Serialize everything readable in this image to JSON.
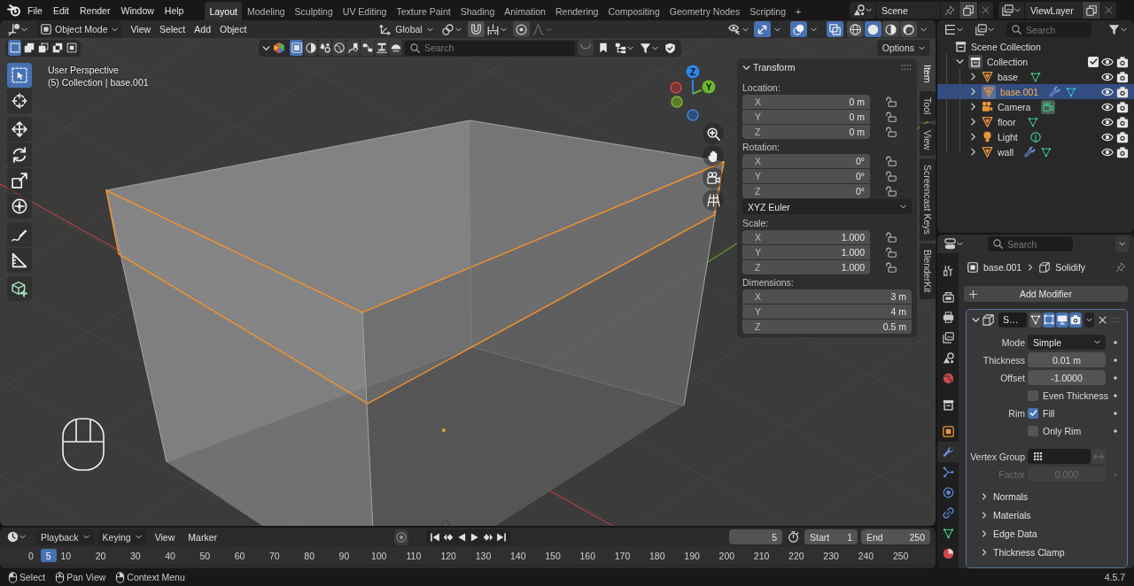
{
  "top_bar": {
    "menus": [
      "File",
      "Edit",
      "Render",
      "Window",
      "Help"
    ],
    "workspaces": [
      {
        "label": "Layout",
        "selected": true
      },
      {
        "label": "Modeling",
        "selected": false
      },
      {
        "label": "Sculpting",
        "selected": false
      },
      {
        "label": "UV Editing",
        "selected": false
      },
      {
        "label": "Texture Paint",
        "selected": false
      },
      {
        "label": "Shading",
        "selected": false
      },
      {
        "label": "Animation",
        "selected": false
      },
      {
        "label": "Rendering",
        "selected": false
      },
      {
        "label": "Compositing",
        "selected": false
      },
      {
        "label": "Geometry Nodes",
        "selected": false
      },
      {
        "label": "Scripting",
        "selected": false
      }
    ],
    "add_workspace": "+",
    "scene": "Scene",
    "view_layer": "ViewLayer"
  },
  "viewport": {
    "header": {
      "mode": "Object Mode",
      "menus": [
        "View",
        "Select",
        "Add",
        "Object"
      ],
      "orientation": "Global",
      "snapping": {
        "on": false
      },
      "proportional_editing": {
        "on": false
      },
      "gizmos": {
        "on": true
      },
      "overlays": {
        "on": true
      },
      "xray": {
        "on": true
      },
      "shading": [
        {
          "kind": "wireframe",
          "selected": false
        },
        {
          "kind": "solid",
          "selected": true
        },
        {
          "kind": "material",
          "selected": false
        },
        {
          "kind": "rendered",
          "selected": false
        }
      ]
    },
    "tool_settings": {
      "select_modes": [
        {
          "kind": "set",
          "selected": true
        },
        {
          "kind": "extend",
          "selected": false
        },
        {
          "kind": "subtract",
          "selected": false
        },
        {
          "kind": "difference",
          "selected": false
        },
        {
          "kind": "intersect",
          "selected": false
        }
      ],
      "asset_types": [
        {
          "kind": "model",
          "selected": true
        },
        {
          "kind": "material",
          "selected": false
        },
        {
          "kind": "scene",
          "selected": false
        },
        {
          "kind": "hdr",
          "selected": false
        },
        {
          "kind": "brush",
          "selected": false
        },
        {
          "kind": "nodegroup",
          "selected": false
        },
        {
          "kind": "printable",
          "selected": false
        },
        {
          "kind": "addon",
          "selected": false
        }
      ],
      "search": {
        "placeholder": "Search"
      },
      "options": "Options"
    },
    "tool_groups": [
      {
        "tools": [
          {
            "kind": "select_box",
            "selected": true
          },
          {
            "kind": "cursor",
            "selected": false
          }
        ]
      },
      {
        "tools": [
          {
            "kind": "move",
            "selected": false
          },
          {
            "kind": "rotate",
            "selected": false
          },
          {
            "kind": "scale",
            "selected": false
          },
          {
            "kind": "transform",
            "selected": false
          }
        ]
      },
      {
        "tools": [
          {
            "kind": "annotate",
            "selected": false
          },
          {
            "kind": "measure",
            "selected": false
          }
        ]
      },
      {
        "tools": [
          {
            "kind": "add_cube",
            "selected": false
          }
        ]
      }
    ],
    "info": {
      "view": "User Perspective",
      "context": "(5) Collection | base.001"
    },
    "gizmo": {
      "axes": [
        {
          "kind": "z",
          "label": "Z",
          "color": "#2e86e8"
        },
        {
          "kind": "y",
          "label": "Y",
          "color": "#6bb82d"
        }
      ]
    },
    "transform": {
      "title": "Transform",
      "groups": [
        {
          "kind": "lockable",
          "label": "Location:",
          "fields": [
            {
              "axis": "X",
              "value": "0 m",
              "locked": false
            },
            {
              "axis": "Y",
              "value": "0 m",
              "locked": false
            },
            {
              "axis": "Z",
              "value": "0 m",
              "locked": false
            }
          ]
        },
        {
          "kind": "lockable",
          "label": "Rotation:",
          "fields": [
            {
              "axis": "X",
              "value": "0°",
              "locked": false
            },
            {
              "axis": "Y",
              "value": "0°",
              "locked": false
            },
            {
              "axis": "Z",
              "value": "0°",
              "locked": false
            }
          ]
        },
        {
          "kind": "dropdown",
          "value": "XYZ Euler"
        },
        {
          "kind": "lockable",
          "label": "Scale:",
          "fields": [
            {
              "axis": "X",
              "value": "1.000",
              "locked": false
            },
            {
              "axis": "Y",
              "value": "1.000",
              "locked": false
            },
            {
              "axis": "Z",
              "value": "1.000",
              "locked": false
            }
          ]
        },
        {
          "kind": "plain",
          "label": "Dimensions:",
          "fields": [
            {
              "axis": "X",
              "value": "3 m"
            },
            {
              "axis": "Y",
              "value": "4 m"
            },
            {
              "axis": "Z",
              "value": "0.5 m"
            }
          ]
        }
      ]
    },
    "sidebar_tabs": [
      {
        "label": "Item",
        "selected": true
      },
      {
        "label": "Tool",
        "selected": false
      },
      {
        "label": "View",
        "selected": false
      },
      {
        "label": "Screencast Keys",
        "selected": false
      },
      {
        "label": "BlenderKit",
        "selected": false
      }
    ]
  },
  "outliner": {
    "search": {
      "placeholder": "Search"
    },
    "tree": [
      {
        "kind": "scene_collection",
        "label": "Scene Collection",
        "selected": false,
        "children": [
          {
            "kind": "collection",
            "label": "Collection",
            "expanded": true,
            "selected": false,
            "checked": true,
            "visible": true,
            "renderable": true,
            "children": [
              {
                "kind": "mesh",
                "label": "base",
                "expanded": false,
                "selected": false,
                "has_modifiers": false,
                "data_active": false,
                "visible": true,
                "renderable": true
              },
              {
                "kind": "mesh",
                "label": "base.001",
                "expanded": false,
                "selected": true,
                "has_modifiers": true,
                "data_active": false,
                "visible": true,
                "renderable": true
              },
              {
                "kind": "camera",
                "label": "Camera",
                "expanded": false,
                "selected": false,
                "has_modifiers": false,
                "data_active": true,
                "visible": true,
                "renderable": true
              },
              {
                "kind": "mesh",
                "label": "floor",
                "expanded": false,
                "selected": false,
                "has_modifiers": false,
                "data_active": false,
                "visible": true,
                "renderable": true
              },
              {
                "kind": "light",
                "label": "Light",
                "expanded": false,
                "selected": false,
                "has_modifiers": false,
                "data_active": false,
                "visible": true,
                "renderable": true
              },
              {
                "kind": "mesh",
                "label": "wall",
                "expanded": false,
                "selected": false,
                "has_modifiers": true,
                "data_active": false,
                "visible": true,
                "renderable": true
              }
            ]
          }
        ]
      }
    ]
  },
  "properties": {
    "search": {
      "placeholder": "Search"
    },
    "tab_groups": [
      {
        "tabs": [
          {
            "kind": "tool",
            "selected": false
          }
        ]
      },
      {
        "tabs": [
          {
            "kind": "render",
            "selected": false
          },
          {
            "kind": "output",
            "selected": false
          },
          {
            "kind": "view_layer",
            "selected": false
          },
          {
            "kind": "scene",
            "selected": false
          },
          {
            "kind": "world",
            "selected": false
          }
        ]
      },
      {
        "tabs": [
          {
            "kind": "collection",
            "selected": false
          }
        ]
      },
      {
        "tabs": [
          {
            "kind": "object",
            "selected": false
          },
          {
            "kind": "modifiers",
            "selected": true
          },
          {
            "kind": "particles",
            "selected": false
          },
          {
            "kind": "physics",
            "selected": false
          },
          {
            "kind": "constraints",
            "selected": false
          },
          {
            "kind": "data",
            "selected": false
          },
          {
            "kind": "material",
            "selected": false
          }
        ]
      }
    ],
    "breadcrumb": {
      "object": "base.001",
      "modifier": "Solidify"
    },
    "add_modifier": "Add Modifier",
    "modifier": {
      "name": "S…",
      "expanded": true,
      "toggles": [
        {
          "kind": "on_cage",
          "on": false
        },
        {
          "kind": "edit_mode",
          "on": true
        },
        {
          "kind": "viewport",
          "on": true
        },
        {
          "kind": "render",
          "on": true
        }
      ],
      "rows": [
        {
          "kind": "dropdown",
          "label": "Mode",
          "value": "Simple",
          "disabled": false
        },
        {
          "kind": "number",
          "label": "Thickness",
          "value": "0.01 m",
          "disabled": false
        },
        {
          "kind": "number",
          "label": "Offset",
          "value": "-1.0000",
          "disabled": false
        },
        {
          "kind": "checkbox",
          "text": "Even Thickness",
          "checked": false,
          "disabled": false
        },
        {
          "kind": "checkbox",
          "label": "Rim",
          "text": "Fill",
          "checked": true,
          "disabled": false
        },
        {
          "kind": "checkbox",
          "text": "Only Rim",
          "checked": false,
          "disabled": false
        },
        {
          "kind": "vertex_group",
          "label": "Vertex Group",
          "disabled": false
        },
        {
          "kind": "number",
          "label": "Factor",
          "value": "0.000",
          "disabled": true
        }
      ],
      "subpanels": [
        {
          "label": "Normals",
          "expanded": false
        },
        {
          "label": "Materials",
          "expanded": false
        },
        {
          "label": "Edge Data",
          "expanded": false
        },
        {
          "label": "Thickness Clamp",
          "expanded": false
        }
      ]
    }
  },
  "timeline": {
    "menus": [
      {
        "kind": "dropdown",
        "label": "Playback"
      },
      {
        "kind": "dropdown",
        "label": "Keying"
      },
      {
        "kind": "menu",
        "label": "View"
      },
      {
        "kind": "menu",
        "label": "Marker"
      }
    ],
    "auto_keying": {
      "on": false
    },
    "current_frame": "5",
    "range": [
      {
        "label": "Start",
        "value": "1"
      },
      {
        "label": "End",
        "value": "250"
      }
    ],
    "ruler": {
      "labels": [
        "0",
        "10",
        "20",
        "30",
        "40",
        "50",
        "60",
        "70",
        "80",
        "90",
        "100",
        "110",
        "120",
        "130",
        "140",
        "150",
        "160",
        "170",
        "180",
        "190",
        "200",
        "210",
        "220",
        "230",
        "240",
        "250"
      ],
      "playhead": {
        "label": "5",
        "level": 0.02
      }
    }
  },
  "status_bar": {
    "hints": [
      {
        "kind": "left",
        "label": "Select"
      },
      {
        "kind": "middle",
        "label": "Pan View"
      },
      {
        "kind": "right",
        "label": "Context Menu"
      }
    ],
    "version": "4.5.7"
  }
}
